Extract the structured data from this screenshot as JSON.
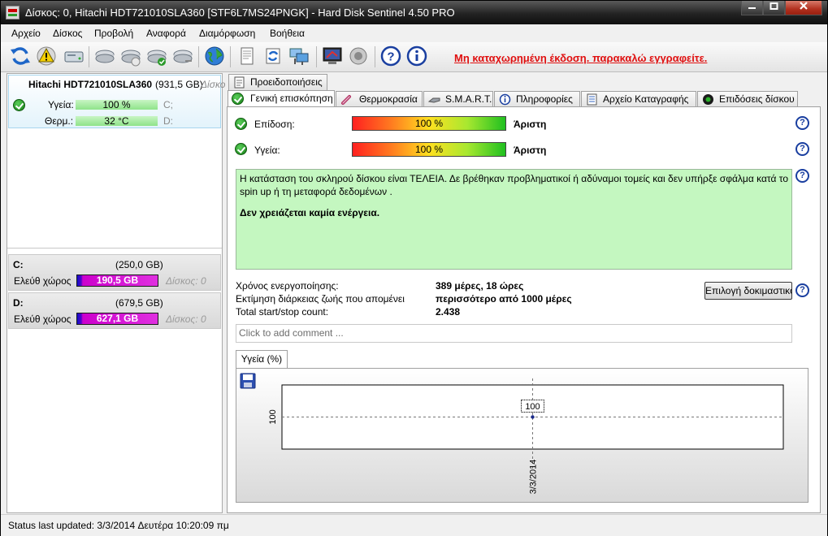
{
  "window": {
    "title": "Δίσκος: 0, Hitachi HDT721010SLA360 [STF6L7MS24PNGK]  -  Hard Disk Sentinel 4.50 PRO",
    "controls": [
      "minimize",
      "maximize",
      "close"
    ]
  },
  "menu": [
    "Αρχείο",
    "Δίσκος",
    "Προβολή",
    "Αναφορά",
    "Διαμόρφωση",
    "Βοήθεια"
  ],
  "toolbar": {
    "icons": [
      "refresh-icon",
      "warning-icon",
      "disk-icon",
      "disk-check-icon",
      "disk-check-icon",
      "disk-check-icon",
      "disk-check-icon",
      "globe-icon",
      "document-icon",
      "sync-icon",
      "network-icon",
      "report-icon",
      "sound-icon",
      "help-icon",
      "info-icon"
    ],
    "register_text": "Μη καταχωρημένη έκδοση. παρακαλώ εγγραφείτε."
  },
  "left_panel": {
    "disk": {
      "name": "Hitachi HDT721010SLA360",
      "size": "(931,5 GB)",
      "word": "Δίσκο",
      "health_label": "Υγεία:",
      "health_value": "100 %",
      "health_pct": 100,
      "temp_label": "Θερμ.:",
      "temp_value": "32 °C",
      "drive_c": "C;",
      "drive_d": "D:"
    },
    "partitions": [
      {
        "letter": "C:",
        "size": "(250,0 GB)",
        "free_label": "Ελεύθ χώρος",
        "free_value": "190,5 GB",
        "disk_label": "Δίσκος: 0"
      },
      {
        "letter": "D:",
        "size": "(679,5 GB)",
        "free_label": "Ελεύθ χώρος",
        "free_value": "627,1 GB",
        "disk_label": "Δίσκος: 0"
      }
    ]
  },
  "tabs": {
    "top": "Προειδοποιήσεις",
    "main": [
      "Γενική επισκόπηση",
      "Θερμοκρασία",
      "S.M.A.R.T.",
      "Πληροφορίες",
      "Αρχείο Καταγραφής",
      "Επιδόσεις δίσκου"
    ]
  },
  "overview": {
    "performance_label": "Επίδοση:",
    "performance_value": "100 %",
    "performance_pct": 100,
    "performance_rating": "Άριστη",
    "health_label": "Υγεία:",
    "health_value": "100 %",
    "health_pct": 100,
    "health_rating": "Άριστη",
    "status_text": "Η κατάσταση του σκληρού δίσκου είναι ΤΕΛΕΙΑ. Δε βρέθηκαν προβληματικοί ή αδύναμοι τομείς και δεν υπήρξε σφάλμα κατά το spin up ή τη μεταφορά δεδομένων .",
    "status_action": "Δεν χρειάζεται καμία ενέργεια.",
    "power_on_label": "Χρόνος ενεργοποίησης:",
    "power_on_value": "389 μέρες, 18 ώρες",
    "lifetime_label": "Εκτίμηση διάρκειας ζωής που απομένει",
    "lifetime_value": "περισσότερο από 1000 μέρες",
    "startstop_label": "Total start/stop count:",
    "startstop_value": "2.438",
    "test_button": "Επιλογή δοκιμαστικού",
    "comment_placeholder": "Click to add comment ...",
    "chart_tab": "Υγεία (%)"
  },
  "chart_data": {
    "type": "line",
    "x": [
      "3/3/2014"
    ],
    "series": [
      {
        "values": [
          100
        ]
      }
    ],
    "point_labels": [
      "100"
    ],
    "y_tick_labels": [
      "100"
    ],
    "grid": true
  },
  "status_bar": "Status last updated: 3/3/2014 Δευτέρα 10:20:09 πμ",
  "colors": {
    "title_gradient": "#232323",
    "status_box": "#c4f7c0",
    "health_bar": "#8fe38a",
    "free_bar": "#cc00cc",
    "register_link": "#e01010"
  }
}
